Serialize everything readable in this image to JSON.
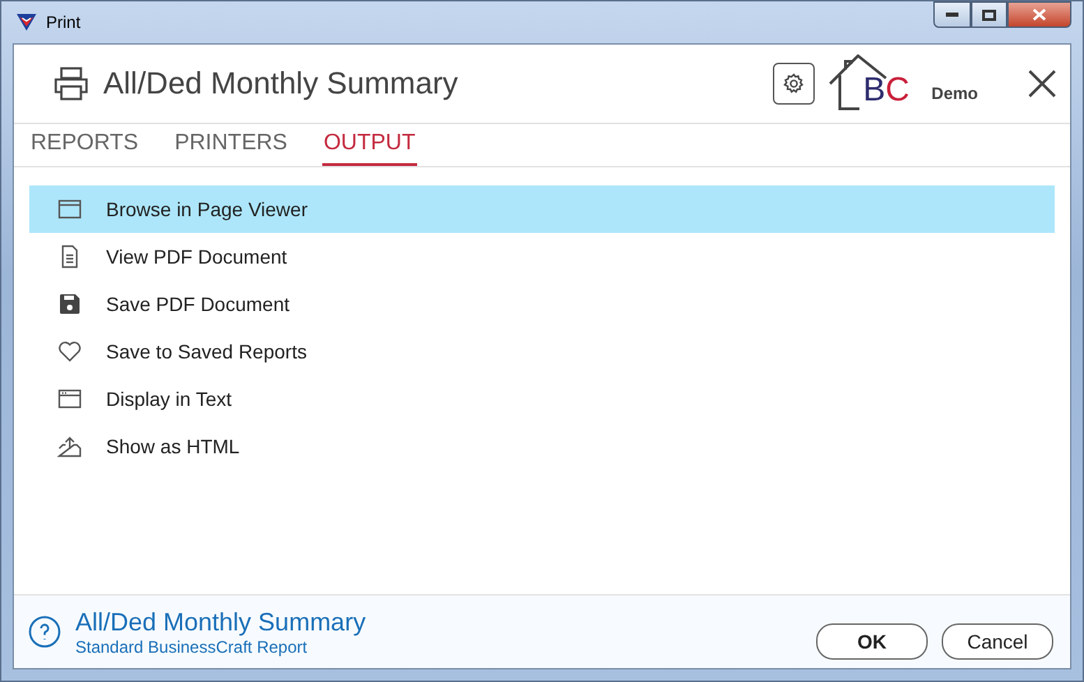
{
  "window": {
    "title": "Print"
  },
  "header": {
    "title": "All/Ded Monthly Summary",
    "logo": {
      "letters": [
        {
          "text": "B",
          "color": "#2e2c6e"
        },
        {
          "text": "C",
          "color": "#c9203a"
        }
      ],
      "caption": "Demo"
    }
  },
  "tabs": [
    {
      "label": "REPORTS",
      "selected": false
    },
    {
      "label": "PRINTERS",
      "selected": false
    },
    {
      "label": "OUTPUT",
      "selected": true
    }
  ],
  "options": [
    {
      "label": "Browse in Page Viewer",
      "kind": "window",
      "selected": true
    },
    {
      "label": "View PDF Document",
      "kind": "document",
      "selected": false
    },
    {
      "label": "Save PDF Document",
      "kind": "floppy",
      "selected": false
    },
    {
      "label": "Save to Saved Reports",
      "kind": "heart",
      "selected": false
    },
    {
      "label": "Display in Text",
      "kind": "textwindow",
      "selected": false
    },
    {
      "label": "Show as HTML",
      "kind": "upload",
      "selected": false
    }
  ],
  "footer": {
    "title": "All/Ded Monthly Summary",
    "subtitle": "Standard BusinessCraft Report",
    "buttons": [
      "OK",
      "Cancel"
    ]
  }
}
